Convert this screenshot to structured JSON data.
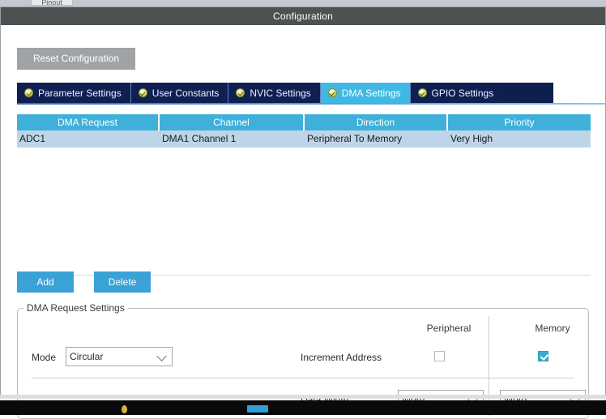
{
  "window": {
    "title": "Configuration",
    "bg_tab_fragment": "Pinout"
  },
  "toolbar": {
    "reset_label": "Reset Configuration"
  },
  "tabs": {
    "items": [
      {
        "label": "Parameter Settings",
        "icon": "check-circle-icon",
        "active": false
      },
      {
        "label": "User Constants",
        "icon": "check-circle-icon",
        "active": false
      },
      {
        "label": "NVIC Settings",
        "icon": "check-circle-icon",
        "active": false
      },
      {
        "label": "DMA Settings",
        "icon": "check-circle-icon",
        "active": true
      },
      {
        "label": "GPIO Settings",
        "icon": "check-circle-icon",
        "active": false
      }
    ]
  },
  "table": {
    "columns": [
      "DMA Request",
      "Channel",
      "Direction",
      "Priority"
    ],
    "rows": [
      {
        "dma_request": "ADC1",
        "channel": "DMA1 Channel 1",
        "direction": "Peripheral To Memory",
        "priority": "Very High",
        "selected": true
      }
    ]
  },
  "actions": {
    "add_label": "Add",
    "delete_label": "Delete"
  },
  "settings": {
    "group_title": "DMA Request Settings",
    "column_headers": {
      "peripheral": "Peripheral",
      "memory": "Memory"
    },
    "mode": {
      "label": "Mode",
      "value": "Circular"
    },
    "increment_address": {
      "label": "Increment Address",
      "peripheral_checked": false,
      "memory_checked": true
    },
    "data_width": {
      "label": "Data Width",
      "peripheral_value": "Word",
      "memory_value": "Word"
    }
  },
  "colors": {
    "titlebar": "#4d5152",
    "tab_active": "#3fb9e4",
    "tab_inactive": "#101f52",
    "table_header": "#3fb0da",
    "row_selected": "#bed5e9",
    "button_blue": "#3ba2d8",
    "checkbox_checked": "#3fa9c6"
  }
}
